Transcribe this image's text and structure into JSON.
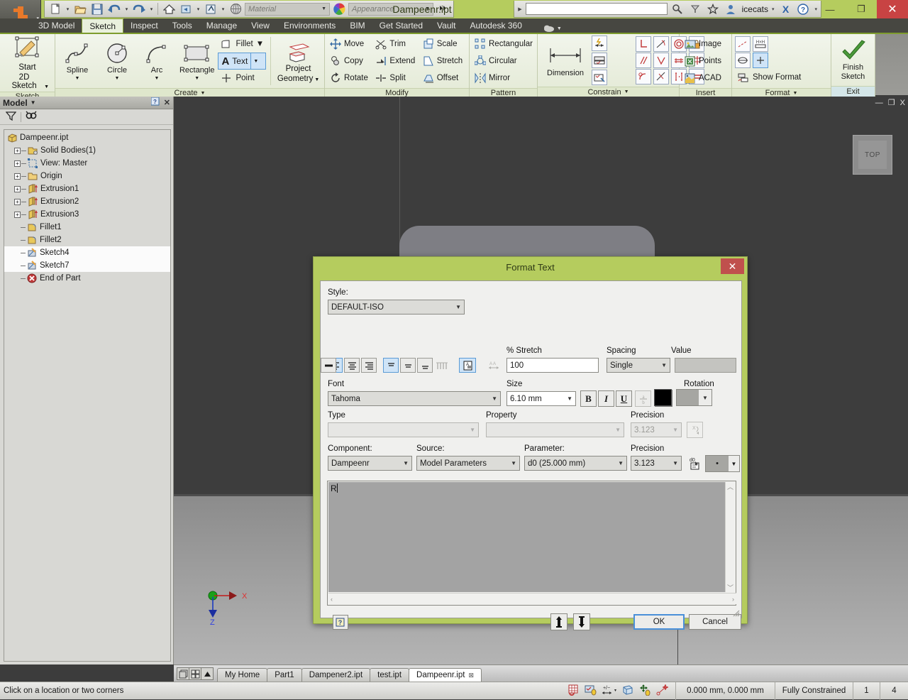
{
  "titlebar": {
    "app_title": "Dampeenr.ipt",
    "material_placeholder": "Material",
    "appearance_placeholder": "Appearance",
    "search_value": "",
    "user": "icecats",
    "minimize": "—",
    "restore": "❐",
    "close": "✕",
    "qat_icons": [
      "new-icon",
      "open-icon",
      "save-icon",
      "undo-icon",
      "redo-icon",
      "home-icon",
      "return-icon",
      "update-icon",
      "select-icon"
    ]
  },
  "ribbon_tabs": [
    {
      "label": "3D Model",
      "active": false
    },
    {
      "label": "Sketch",
      "active": true
    },
    {
      "label": "Inspect",
      "active": false
    },
    {
      "label": "Tools",
      "active": false
    },
    {
      "label": "Manage",
      "active": false
    },
    {
      "label": "View",
      "active": false
    },
    {
      "label": "Environments",
      "active": false
    },
    {
      "label": "BIM",
      "active": false
    },
    {
      "label": "Get Started",
      "active": false
    },
    {
      "label": "Vault",
      "active": false
    },
    {
      "label": "Autodesk 360",
      "active": false
    }
  ],
  "ribbon": {
    "panels": [
      {
        "title": "Sketch",
        "has_dropdown": false,
        "buttons": [
          {
            "label": "Start\n2D Sketch",
            "line1": "Start",
            "line2": "2D Sketch"
          }
        ]
      },
      {
        "title": "Create",
        "has_dropdown": true,
        "buttons": [
          {
            "line1": "Spline",
            "line2": ""
          },
          {
            "line1": "Circle",
            "line2": ""
          },
          {
            "line1": "Arc",
            "line2": ""
          },
          {
            "line1": "Rectangle",
            "line2": ""
          }
        ],
        "small": [
          "Fillet",
          "Text",
          "Point"
        ],
        "project": {
          "line1": "Project",
          "line2": "Geometry"
        }
      },
      {
        "title": "Modify",
        "has_dropdown": false,
        "items": [
          "Move",
          "Trim",
          "Scale",
          "Copy",
          "Extend",
          "Stretch",
          "Rotate",
          "Split",
          "Offset"
        ]
      },
      {
        "title": "Pattern",
        "has_dropdown": false,
        "items": [
          "Rectangular",
          "Circular",
          "Mirror"
        ]
      },
      {
        "title": "Constrain",
        "has_dropdown": true,
        "dimension_label": "Dimension"
      },
      {
        "title": "Insert",
        "has_dropdown": false,
        "items": [
          "Image",
          "Points",
          "ACAD"
        ]
      },
      {
        "title": "Format",
        "has_dropdown": true,
        "items": [
          "Show Format"
        ]
      },
      {
        "title": "Exit",
        "has_dropdown": false,
        "buttons": [
          {
            "line1": "Finish",
            "line2": "Sketch"
          }
        ]
      }
    ]
  },
  "browser": {
    "panel_title": "Model",
    "help_icon": "help-icon",
    "filter_icon": "filter-icon",
    "find_icon": "find-icon",
    "tree": [
      {
        "label": "Dampeenr.ipt",
        "depth": 0,
        "expander": "none",
        "icon": "part-icon",
        "highlight": false
      },
      {
        "label": "Solid Bodies(1)",
        "depth": 1,
        "expander": "plus",
        "icon": "solid-bodies-icon",
        "highlight": false
      },
      {
        "label": "View: Master",
        "depth": 1,
        "expander": "plus",
        "icon": "view-icon",
        "highlight": false
      },
      {
        "label": "Origin",
        "depth": 1,
        "expander": "plus",
        "icon": "folder-icon",
        "highlight": false
      },
      {
        "label": "Extrusion1",
        "depth": 1,
        "expander": "plus",
        "icon": "extrusion-icon",
        "highlight": false
      },
      {
        "label": "Extrusion2",
        "depth": 1,
        "expander": "plus",
        "icon": "extrusion-icon",
        "highlight": false
      },
      {
        "label": "Extrusion3",
        "depth": 1,
        "expander": "plus",
        "icon": "extrusion-icon",
        "highlight": false
      },
      {
        "label": "Fillet1",
        "depth": 1,
        "expander": "none",
        "icon": "fillet-icon",
        "highlight": false
      },
      {
        "label": "Fillet2",
        "depth": 1,
        "expander": "none",
        "icon": "fillet-icon",
        "highlight": false
      },
      {
        "label": "Sketch4",
        "depth": 1,
        "expander": "none",
        "icon": "sketch-icon",
        "highlight": true
      },
      {
        "label": "Sketch7",
        "depth": 1,
        "expander": "none",
        "icon": "sketch-icon",
        "highlight": true
      },
      {
        "label": "End of Part",
        "depth": 1,
        "expander": "none",
        "icon": "end-of-part-icon",
        "highlight": false
      }
    ]
  },
  "viewport": {
    "viewcube_label": "TOP",
    "axis_x": "X",
    "axis_z": "Z",
    "doc_minimize": "—",
    "doc_restore": "❐",
    "doc_close": "X"
  },
  "dialog": {
    "title": "Format Text",
    "close": "✕",
    "style_label": "Style:",
    "style_value": "DEFAULT-ISO",
    "stretch_label": "% Stretch",
    "stretch_value": "100",
    "spacing_label": "Spacing",
    "spacing_value": "Single",
    "value_label": "Value",
    "value_value": "",
    "font_label": "Font",
    "font_value": "Tahoma",
    "size_label": "Size",
    "size_value": "6.10 mm",
    "bold": "B",
    "italic": "I",
    "underline": "U",
    "stack_icon": "stack-fraction-icon",
    "color_swatch": "#000000",
    "rotation_label": "Rotation",
    "type_label": "Type",
    "type_value": "",
    "property_label": "Property",
    "property_value": "",
    "precision_label_1": "Precision",
    "precision_value_1": "3.123",
    "component_label": "Component:",
    "component_value": "Dampeenr",
    "source_label": "Source:",
    "source_value": "Model Parameters",
    "parameter_label": "Parameter:",
    "parameter_value": "d0 (25.000 mm)",
    "precision_label_2": "Precision",
    "precision_value_2": "3.123",
    "insert_param_icon": "insert-parameter-icon",
    "symbol_value": "•",
    "text_content": "R",
    "help_btn": "help-icon",
    "move_up_icon": "move-up-icon",
    "move_down_icon": "move-down-icon",
    "ok_label": "OK",
    "cancel_label": "Cancel",
    "align_buttons": [
      "align-left",
      "align-center",
      "align-right",
      "align-top",
      "align-middle",
      "align-bottom",
      "align-distribute",
      "insert-symbol",
      "kerning"
    ]
  },
  "doctabs": {
    "nav_icons": [
      "tile-icon",
      "cascade-icon",
      "scroll-up-icon"
    ],
    "tabs": [
      {
        "label": "My Home",
        "active": false,
        "closable": false
      },
      {
        "label": "Part1",
        "active": false,
        "closable": false
      },
      {
        "label": "Dampener2.ipt",
        "active": false,
        "closable": false
      },
      {
        "label": "test.ipt",
        "active": false,
        "closable": false
      },
      {
        "label": "Dampeenr.ipt",
        "active": true,
        "closable": true,
        "close": "⊠"
      }
    ]
  },
  "statusbar": {
    "message": "Click on a location or two corners",
    "coordinates": "0.000 mm, 0.000 mm",
    "constraint_state": "Fully Constrained",
    "count_1": "1",
    "count_2": "4",
    "icons": [
      "grid-snap-icon",
      "constraint-infer-icon",
      "dimension-icon",
      "slice-graphics-icon",
      "snap-point-icon",
      "dof-icon"
    ]
  },
  "colors": {
    "brand_green": "#b5cc5e",
    "accent_blue": "#5b9bd5",
    "close_red": "#c0504d",
    "viewport_dark": "#3d3d3d"
  }
}
